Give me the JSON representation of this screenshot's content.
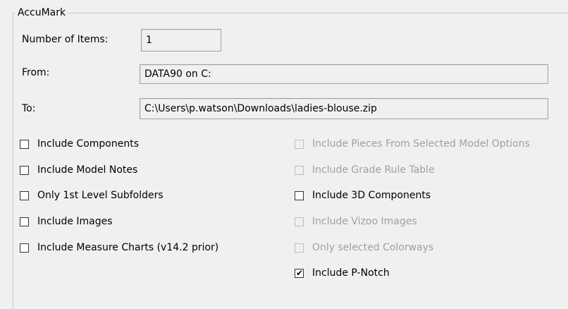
{
  "group": {
    "title": "AccuMark"
  },
  "fields": {
    "items_label": "Number of Items:",
    "items_value": "1",
    "from_label": "From:",
    "from_value": "DATA90 on C:",
    "to_label": "To:",
    "to_value": "C:\\Users\\p.watson\\Downloads\\ladies-blouse.zip"
  },
  "options": {
    "include_components": {
      "label": "Include Components",
      "checked": false,
      "enabled": true
    },
    "include_model_notes": {
      "label": "Include Model Notes",
      "checked": false,
      "enabled": true
    },
    "only_1st_level_subfolders": {
      "label": "Only 1st Level Subfolders",
      "checked": false,
      "enabled": true
    },
    "include_images": {
      "label": "Include Images",
      "checked": false,
      "enabled": true
    },
    "include_measure_charts": {
      "label": "Include Measure Charts (v14.2  prior)",
      "checked": false,
      "enabled": true
    },
    "include_pieces_selected_options": {
      "label": "Include Pieces From Selected Model Options",
      "checked": false,
      "enabled": false
    },
    "include_grade_rule_table": {
      "label": "Include Grade Rule Table",
      "checked": false,
      "enabled": false
    },
    "include_3d_components": {
      "label": "Include 3D Components",
      "checked": false,
      "enabled": true
    },
    "include_vizoo_images": {
      "label": "Include Vizoo Images",
      "checked": false,
      "enabled": false
    },
    "only_selected_colorways": {
      "label": "Only selected Colorways",
      "checked": false,
      "enabled": false
    },
    "include_p_notch": {
      "label": "Include P-Notch",
      "checked": true,
      "enabled": true
    }
  },
  "icons": {
    "checkmark": "✔"
  }
}
